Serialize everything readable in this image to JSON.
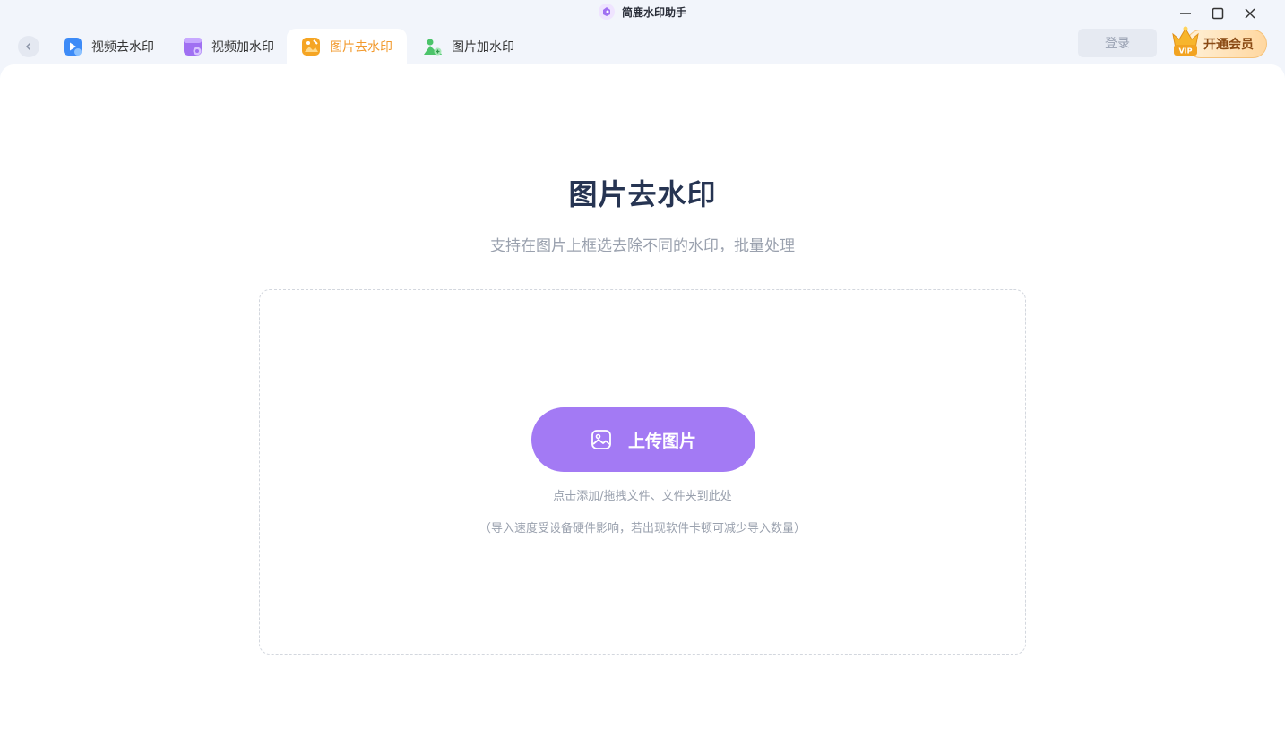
{
  "app": {
    "title": "简鹿水印助手"
  },
  "tabs": [
    {
      "label": "视频去水印",
      "icon": "video-remove-icon",
      "color": "#3d8bf7",
      "active": false
    },
    {
      "label": "视频加水印",
      "icon": "video-add-icon",
      "color": "#a070f2",
      "active": false
    },
    {
      "label": "图片去水印",
      "icon": "image-remove-icon",
      "color": "#f5a524",
      "active": true
    },
    {
      "label": "图片加水印",
      "icon": "image-add-icon",
      "color": "#4cc46a",
      "active": false
    }
  ],
  "header": {
    "login_label": "登录",
    "vip_label": "开通会员",
    "vip_badge": "VIP"
  },
  "main": {
    "title": "图片去水印",
    "subtitle": "支持在图片上框选去除不同的水印，批量处理",
    "upload_label": "上传图片",
    "hint_primary": "点击添加/拖拽文件、文件夹到此处",
    "hint_secondary": "（导入速度受设备硬件影响，若出现软件卡顿可减少导入数量）"
  },
  "colors": {
    "accent": "#a37af4",
    "active_tab": "#f29a2e",
    "title": "#263452"
  }
}
